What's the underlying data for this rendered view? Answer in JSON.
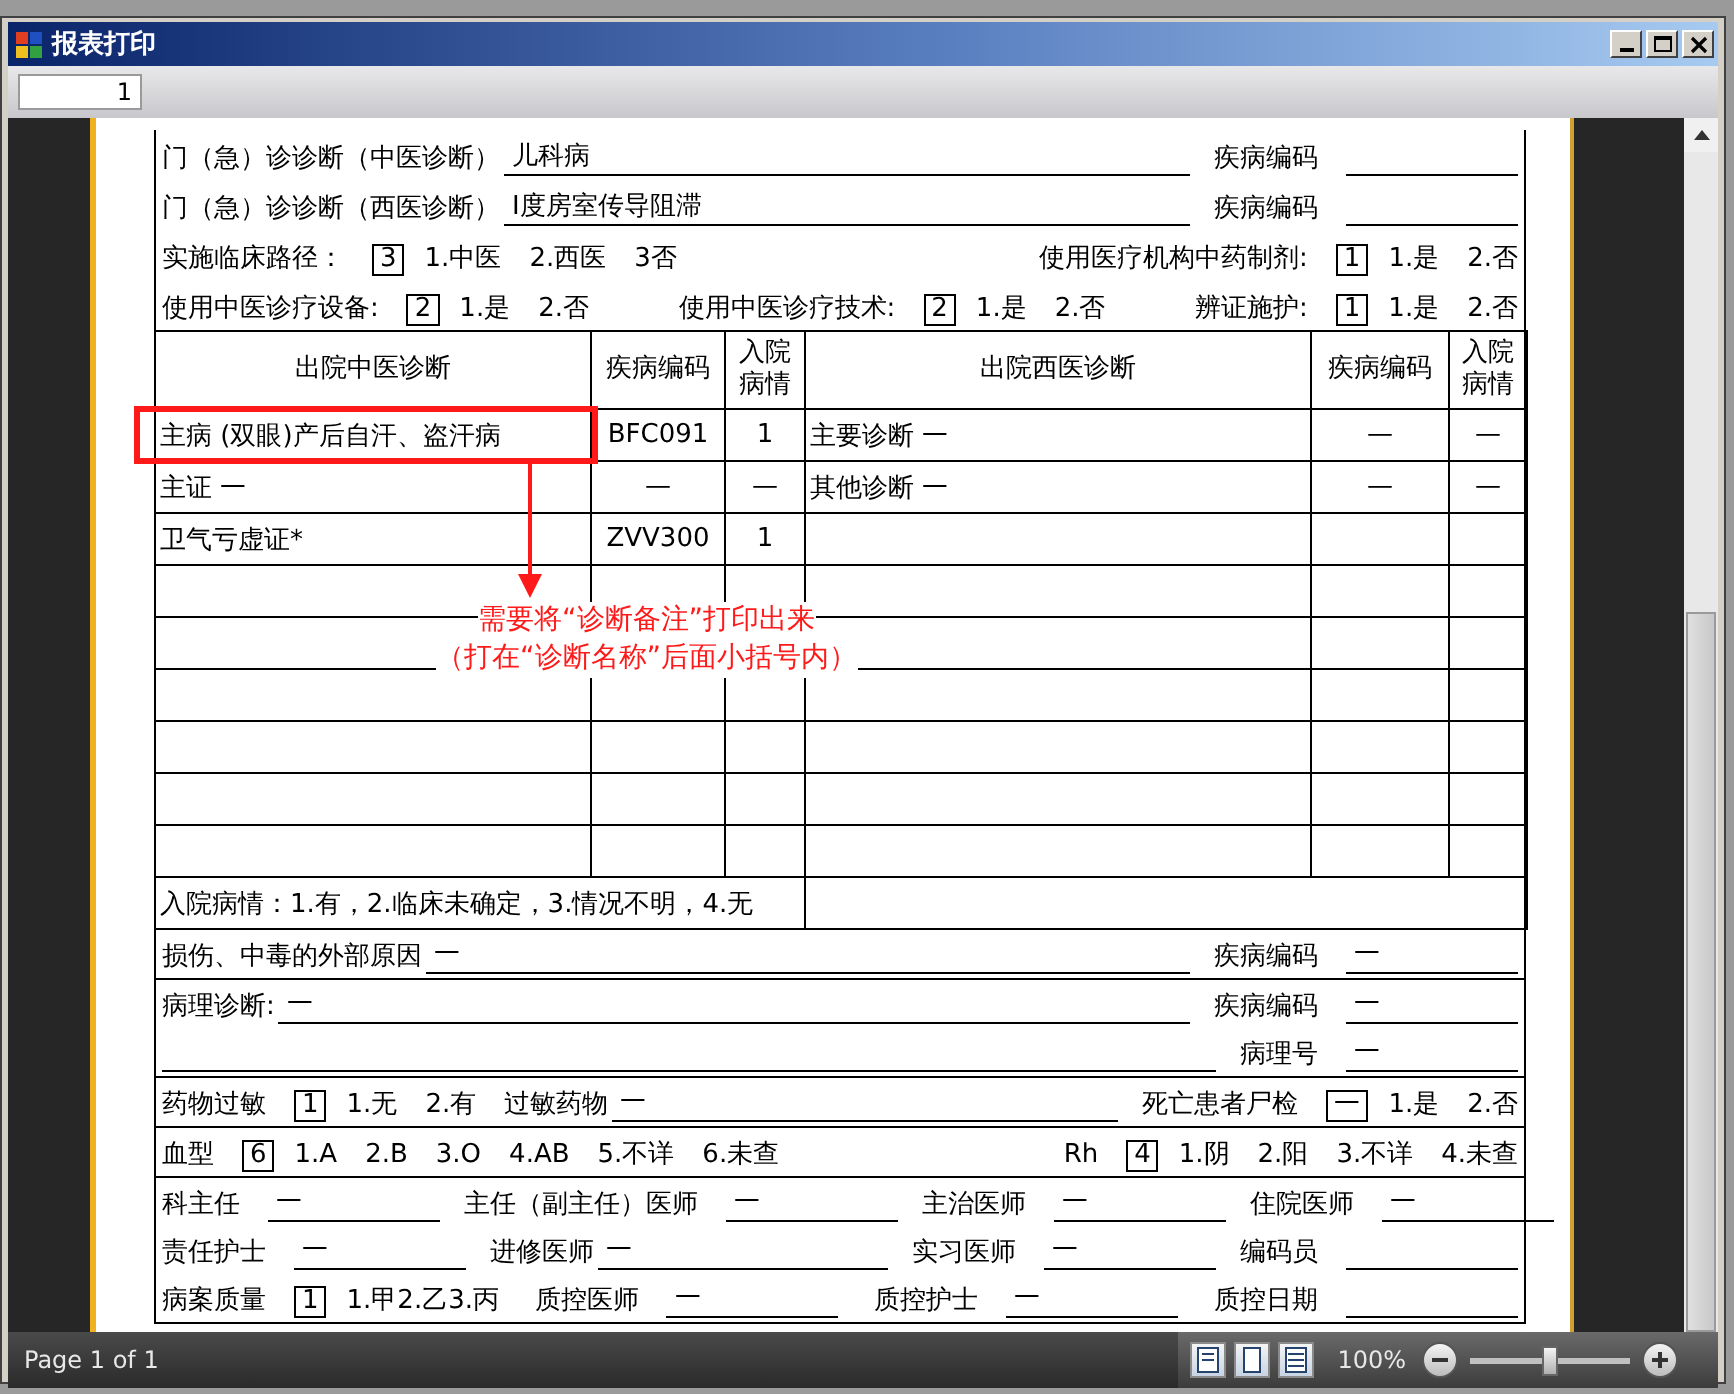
{
  "window": {
    "title": "报表打印"
  },
  "toolbar": {
    "page_field": "1"
  },
  "form": {
    "top_rows": [
      {
        "groups": [
          [
            {
              "kind": "text",
              "text": "门（急）诊诊断（中医诊断）"
            },
            {
              "kind": "wide-field",
              "text": "儿科病"
            }
          ],
          [
            {
              "kind": "text",
              "text": "疾病编码"
            },
            {
              "kind": "field"
            }
          ]
        ]
      },
      {
        "groups": [
          [
            {
              "kind": "text",
              "text": "门（急）诊诊断（西医诊断）"
            },
            {
              "kind": "wide-field",
              "text": "Ⅰ度房室传导阻滞"
            }
          ],
          [
            {
              "kind": "text",
              "text": "疾病编码"
            },
            {
              "kind": "field"
            }
          ]
        ]
      },
      {
        "groups": [
          [
            {
              "kind": "text",
              "text": "实施临床路径："
            },
            {
              "kind": "box",
              "text": "3"
            },
            {
              "kind": "text",
              "text": "1.中医"
            },
            {
              "kind": "text",
              "text": "2.西医"
            },
            {
              "kind": "text",
              "text": "3否"
            }
          ],
          [
            {
              "kind": "text",
              "text": "使用医疗机构中药制剂:"
            },
            {
              "kind": "box",
              "text": "1"
            },
            {
              "kind": "text",
              "text": "1.是"
            },
            {
              "kind": "text",
              "text": "2.否"
            }
          ]
        ]
      },
      {
        "groups": [
          [
            {
              "kind": "text",
              "text": "使用中医诊疗设备:"
            },
            {
              "kind": "box",
              "text": "2"
            },
            {
              "kind": "text",
              "text": "1.是"
            },
            {
              "kind": "text",
              "text": "2.否"
            }
          ],
          [
            {
              "kind": "text",
              "text": "使用中医诊疗技术:"
            },
            {
              "kind": "box",
              "text": "2"
            },
            {
              "kind": "text",
              "text": "1.是"
            },
            {
              "kind": "text",
              "text": "2.否"
            }
          ],
          [
            {
              "kind": "text",
              "text": "辨证施护:"
            },
            {
              "kind": "box",
              "text": "1"
            },
            {
              "kind": "text",
              "text": "1.是"
            },
            {
              "kind": "text",
              "text": "2.否"
            }
          ]
        ]
      }
    ],
    "table": {
      "columns": [
        "出院中医诊断",
        "疾病编码",
        "入院病情",
        "出院西医诊断",
        "疾病编码",
        "入院病情"
      ],
      "rows": [
        [
          "主病 (双眼)产后自汗、盗汗病",
          "BFC091",
          "1",
          "主要诊断 一",
          "—",
          "—"
        ],
        [
          "主证 一",
          "—",
          "—",
          "其他诊断 一",
          "—",
          "—"
        ],
        [
          " 卫气亏虚证*",
          "ZVV300",
          "1",
          null,
          null,
          null
        ],
        [
          null,
          null,
          null,
          null,
          null,
          null
        ],
        [
          null,
          null,
          null,
          null,
          null,
          null
        ],
        [
          null,
          null,
          null,
          null,
          null,
          null
        ],
        [
          null,
          null,
          null,
          null,
          null,
          null
        ],
        [
          null,
          null,
          null,
          null,
          null,
          null
        ],
        [
          null,
          null,
          null,
          null,
          null,
          null
        ]
      ],
      "legend": "入院病情：1.有，2.临床未确定，3.情况不明，4.无"
    },
    "annotation": {
      "lines": [
        "需要将“诊断备注”打印出来",
        "（打在“诊断名称”后面小括号内）"
      ]
    },
    "footer_blocks": [
      [
        {
          "groups": [
            [
              {
                "kind": "text",
                "text": "损伤、中毒的外部原因"
              },
              {
                "kind": "wide-field",
                "text": "一"
              }
            ],
            [
              {
                "kind": "text",
                "text": "疾病编码"
              },
              {
                "kind": "field",
                "text": "一"
              }
            ]
          ]
        }
      ],
      [
        {
          "groups": [
            [
              {
                "kind": "text",
                "text": "病理诊断:"
              },
              {
                "kind": "wide-field",
                "text": "一"
              }
            ],
            [
              {
                "kind": "text",
                "text": "疾病编码"
              },
              {
                "kind": "field",
                "text": "一"
              }
            ]
          ]
        },
        {
          "groups": [
            [
              {
                "kind": "wide-field"
              }
            ],
            [
              {
                "kind": "text",
                "text": "病理号"
              },
              {
                "kind": "field",
                "text": "一"
              }
            ]
          ]
        }
      ],
      [
        {
          "groups": [
            [
              {
                "kind": "text",
                "text": "药物过敏"
              },
              {
                "kind": "box",
                "text": "1"
              },
              {
                "kind": "text",
                "text": "1.无"
              },
              {
                "kind": "text",
                "text": "2.有"
              },
              {
                "kind": "text",
                "text": "过敏药物"
              },
              {
                "kind": "wide-field",
                "text": "一"
              }
            ],
            [
              {
                "kind": "text",
                "text": "死亡患者尸检"
              },
              {
                "kind": "box",
                "text": "一"
              },
              {
                "kind": "text",
                "text": "1.是"
              },
              {
                "kind": "text",
                "text": "2.否"
              }
            ]
          ]
        }
      ],
      [
        {
          "groups": [
            [
              {
                "kind": "text",
                "text": "血型"
              },
              {
                "kind": "box",
                "text": "6"
              },
              {
                "kind": "text",
                "text": "1.A"
              },
              {
                "kind": "text",
                "text": "2.B"
              },
              {
                "kind": "text",
                "text": "3.O"
              },
              {
                "kind": "text",
                "text": "4.AB"
              },
              {
                "kind": "text",
                "text": "5.不详"
              },
              {
                "kind": "text",
                "text": "6.未查"
              }
            ],
            [
              {
                "kind": "text",
                "text": "Rh"
              },
              {
                "kind": "box",
                "text": "4"
              },
              {
                "kind": "text",
                "text": "1.阴"
              },
              {
                "kind": "text",
                "text": "2.阳"
              },
              {
                "kind": "text",
                "text": "3.不详"
              },
              {
                "kind": "text",
                "text": "4.未查"
              }
            ]
          ]
        }
      ],
      [
        {
          "groups": [
            [
              {
                "kind": "text",
                "text": "科主任"
              },
              {
                "kind": "field",
                "text": "一"
              }
            ],
            [
              {
                "kind": "text",
                "text": "主任（副主任）医师"
              },
              {
                "kind": "field",
                "text": "一"
              }
            ],
            [
              {
                "kind": "text",
                "text": "主治医师"
              },
              {
                "kind": "field",
                "text": "一"
              }
            ],
            [
              {
                "kind": "text",
                "text": "住院医师"
              },
              {
                "kind": "field",
                "text": "一"
              }
            ]
          ]
        },
        {
          "groups": [
            [
              {
                "kind": "text",
                "text": "责任护士"
              },
              {
                "kind": "field",
                "text": "一"
              }
            ],
            [
              {
                "kind": "text",
                "text": "进修医师"
              },
              {
                "kind": "wide-field",
                "text": "一"
              }
            ],
            [
              {
                "kind": "text",
                "text": "实习医师"
              },
              {
                "kind": "field",
                "text": "一"
              }
            ],
            [
              {
                "kind": "text",
                "text": "编码员"
              },
              {
                "kind": "field"
              }
            ]
          ]
        },
        {
          "groups": [
            [
              {
                "kind": "text",
                "text": "病案质量"
              },
              {
                "kind": "box",
                "text": "1"
              },
              {
                "kind": "text",
                "text": "1.甲2.乙3.丙"
              }
            ],
            [
              {
                "kind": "text",
                "text": "质控医师"
              },
              {
                "kind": "field",
                "text": "一"
              }
            ],
            [
              {
                "kind": "text",
                "text": "质控护士"
              },
              {
                "kind": "field",
                "text": "一"
              }
            ],
            [
              {
                "kind": "text",
                "text": "质控日期"
              },
              {
                "kind": "field"
              }
            ]
          ]
        }
      ]
    ]
  },
  "status_bar": {
    "page_info": "Page 1 of 1",
    "zoom": "100%",
    "zoom_slider": {
      "level": 0.5
    }
  }
}
